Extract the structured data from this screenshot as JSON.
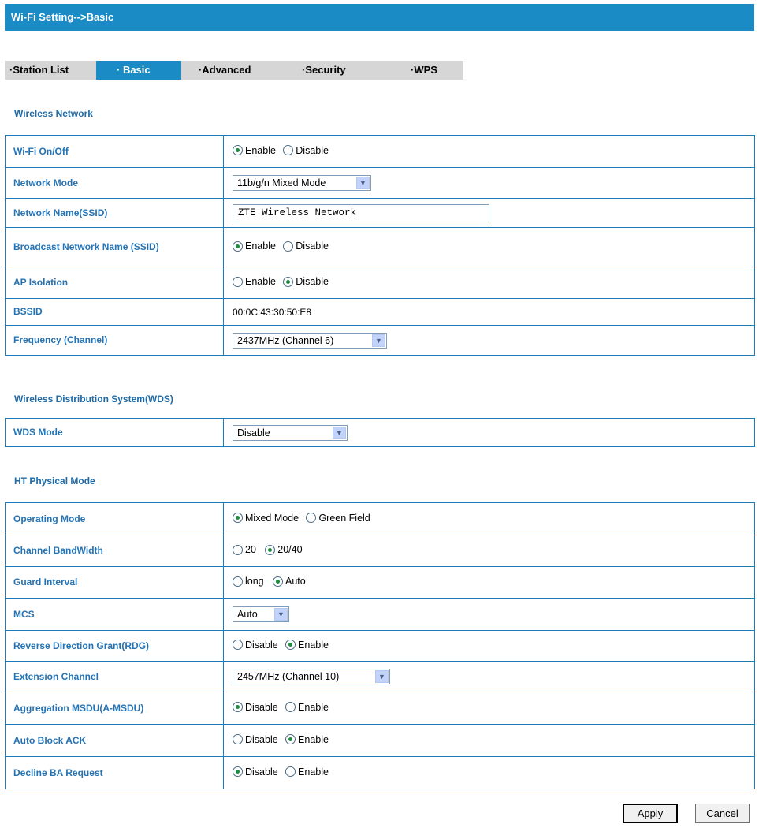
{
  "header": {
    "title": "Wi-Fi Setting-->Basic"
  },
  "tabs": [
    {
      "label": "·Station List"
    },
    {
      "label": "· Basic"
    },
    {
      "label": "·Advanced"
    },
    {
      "label": "·Security"
    },
    {
      "label": "·WPS"
    }
  ],
  "active_tab": "Basic",
  "wireless": {
    "title": "Wireless Network",
    "wifi_onoff": {
      "label": "Wi-Fi On/Off",
      "opt1": "Enable",
      "opt2": "Disable",
      "selected": "Enable"
    },
    "network_mode": {
      "label": "Network Mode",
      "value": "11b/g/n Mixed Mode"
    },
    "ssid": {
      "label": "Network Name(SSID)",
      "value": "ZTE Wireless Network"
    },
    "broadcast": {
      "label": "Broadcast Network Name (SSID)",
      "opt1": "Enable",
      "opt2": "Disable",
      "selected": "Enable"
    },
    "ap_isolation": {
      "label": "AP Isolation",
      "opt1": "Enable",
      "opt2": "Disable",
      "selected": "Disable"
    },
    "bssid": {
      "label": "BSSID",
      "value": "00:0C:43:30:50:E8"
    },
    "frequency": {
      "label": "Frequency (Channel)",
      "value": "2437MHz (Channel 6)"
    }
  },
  "wds": {
    "title": "Wireless Distribution System(WDS)",
    "mode": {
      "label": "WDS Mode",
      "value": "Disable"
    }
  },
  "ht": {
    "title": "HT Physical Mode",
    "operating_mode": {
      "label": "Operating Mode",
      "opt1": "Mixed Mode",
      "opt2": "Green Field",
      "selected": "Mixed Mode"
    },
    "bandwidth": {
      "label": "Channel BandWidth",
      "opt1": "20",
      "opt2": "20/40",
      "selected": "20/40"
    },
    "guard": {
      "label": "Guard Interval",
      "opt1": "long",
      "opt2": "Auto",
      "selected": "Auto"
    },
    "mcs": {
      "label": "MCS",
      "value": "Auto"
    },
    "rdg": {
      "label": "Reverse Direction Grant(RDG)",
      "opt1": "Disable",
      "opt2": "Enable",
      "selected": "Enable"
    },
    "ext_channel": {
      "label": "Extension Channel",
      "value": "2457MHz (Channel 10)"
    },
    "amsdu": {
      "label": "Aggregation MSDU(A-MSDU)",
      "opt1": "Disable",
      "opt2": "Enable",
      "selected": "Disable"
    },
    "auto_block_ack": {
      "label": "Auto Block ACK",
      "opt1": "Disable",
      "opt2": "Enable",
      "selected": "Enable"
    },
    "decline_ba": {
      "label": "Decline BA Request",
      "opt1": "Disable",
      "opt2": "Enable",
      "selected": "Disable"
    }
  },
  "buttons": {
    "apply": "Apply",
    "cancel": "Cancel"
  },
  "colors": {
    "accent": "#1a8bc4",
    "label_text": "#2573b3",
    "border": "#1f7ab8",
    "tab_bar": "#d6d6d6"
  }
}
